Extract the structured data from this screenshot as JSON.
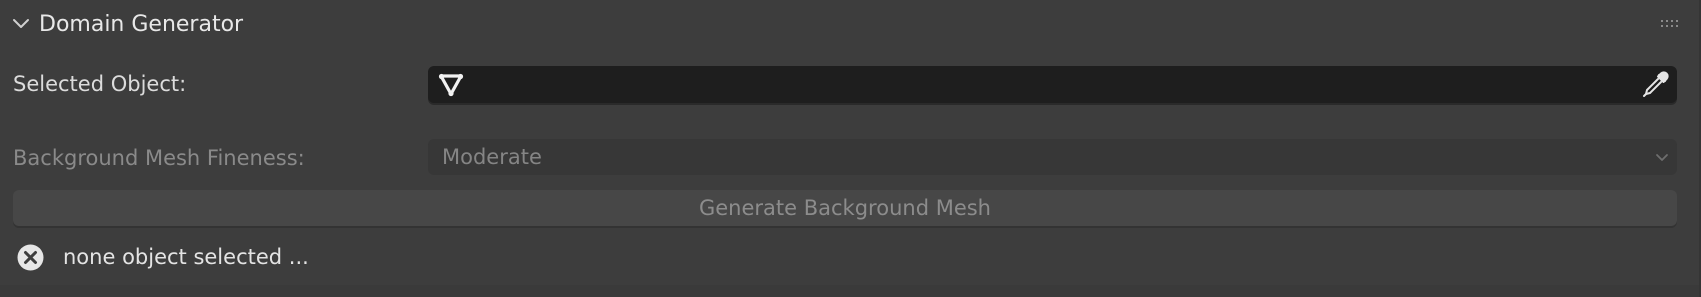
{
  "panel": {
    "title": "Domain Generator",
    "expanded": true,
    "collapse_icon": "chevron-down-icon",
    "drag_icon": "grip-dots-icon"
  },
  "selected_object": {
    "label": "Selected Object:",
    "value": "",
    "type_icon": "mesh-triangle-icon",
    "picker_icon": "eyedropper-icon"
  },
  "fineness": {
    "label": "Background Mesh Fineness:",
    "value": "Moderate",
    "enabled": false
  },
  "generate_button": {
    "label": "Generate Background Mesh",
    "enabled": false
  },
  "status": {
    "icon": "error-x-circle-icon",
    "text": "none object selected ..."
  },
  "colors": {
    "panel_bg": "#3d3d3d",
    "field_bg": "#1e1e1e",
    "disabled_text": "#858585",
    "button_bg": "#474747"
  }
}
